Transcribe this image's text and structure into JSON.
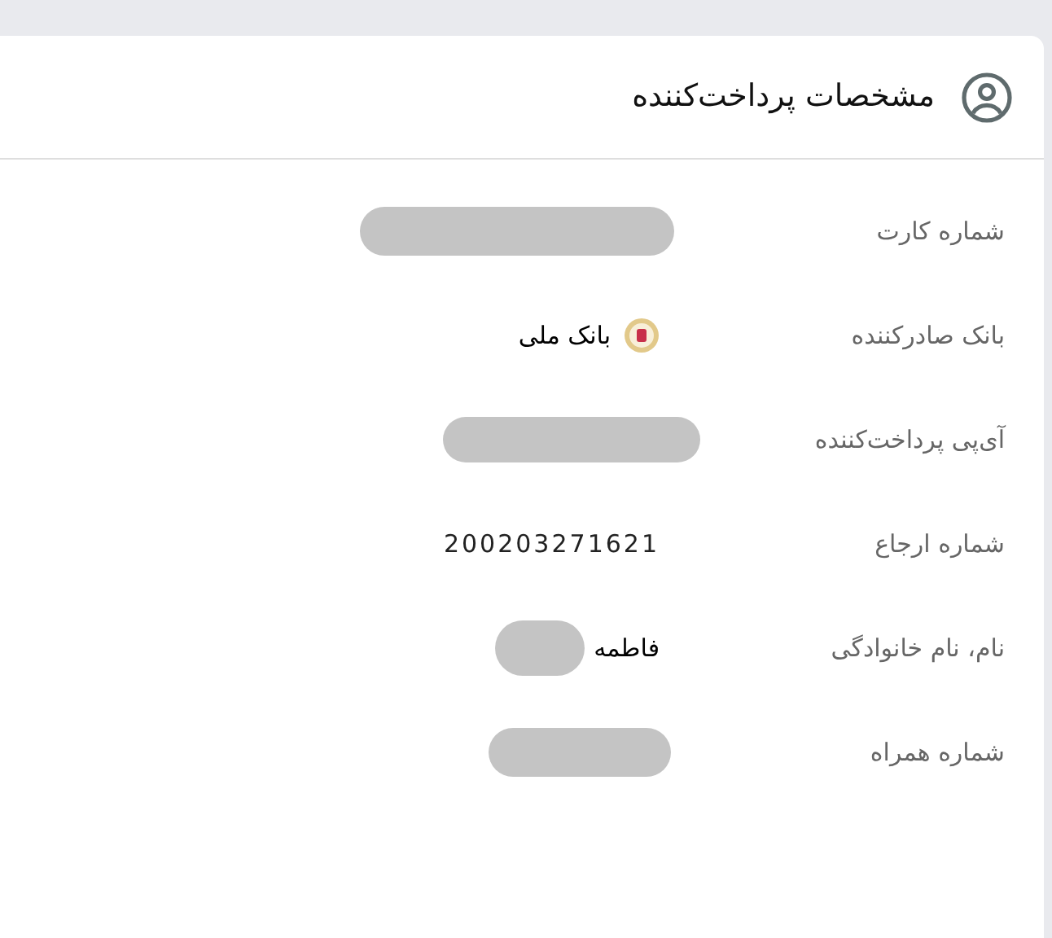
{
  "header": {
    "title": "مشخصات پرداخت‌کننده"
  },
  "rows": [
    {
      "label": "شماره کارت",
      "kind": "text",
      "redacted": true
    },
    {
      "label": "بانک صادرکننده",
      "kind": "bank",
      "value": "بانک ملی",
      "redacted": false
    },
    {
      "label": "آی‌پی پرداخت‌کننده",
      "kind": "text",
      "redacted": true
    },
    {
      "label": "شماره ارجاع",
      "kind": "number",
      "value": "200203271621",
      "redacted": false
    },
    {
      "label": "نام، نام خانوادگی",
      "kind": "text",
      "value": "فاطمه",
      "redacted": true
    },
    {
      "label": "شماره همراه",
      "kind": "text",
      "redacted": true
    }
  ]
}
